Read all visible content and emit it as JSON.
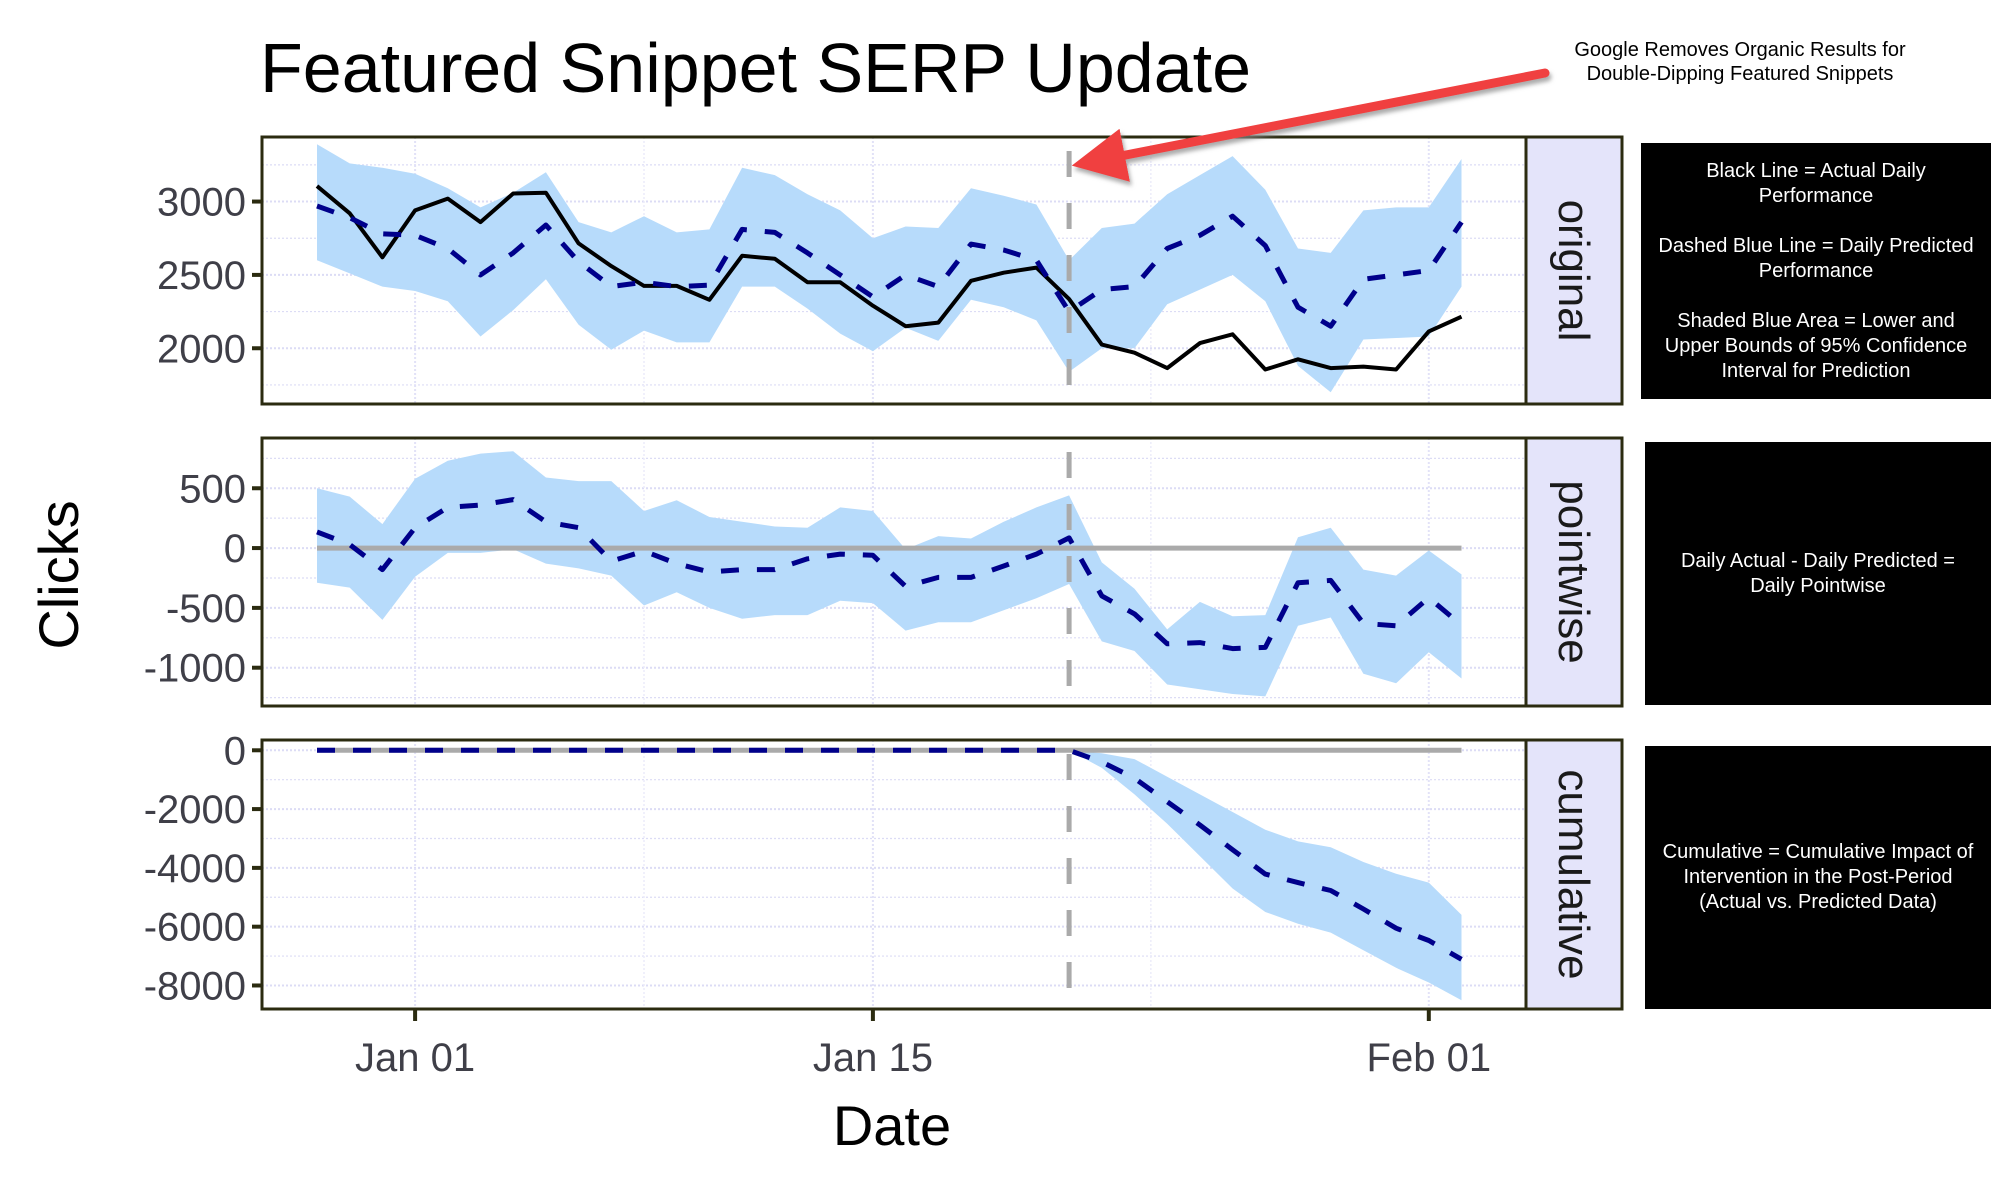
{
  "chart_data": {
    "type": "line",
    "title": "Featured Snippet SERP Update",
    "xlabel": "Date",
    "ylabel": "Clicks",
    "x_ticks": [
      "Jan 01",
      "Jan 15",
      "Feb 01"
    ],
    "x": [
      "Dec 29",
      "Dec 30",
      "Dec 31",
      "Jan 01",
      "Jan 02",
      "Jan 03",
      "Jan 04",
      "Jan 05",
      "Jan 06",
      "Jan 07",
      "Jan 08",
      "Jan 09",
      "Jan 10",
      "Jan 11",
      "Jan 12",
      "Jan 13",
      "Jan 14",
      "Jan 15",
      "Jan 16",
      "Jan 17",
      "Jan 18",
      "Jan 19",
      "Jan 20",
      "Jan 21",
      "Jan 22",
      "Jan 23",
      "Jan 24",
      "Jan 25",
      "Jan 26",
      "Jan 27",
      "Jan 28",
      "Jan 29",
      "Jan 30",
      "Jan 31",
      "Feb 01",
      "Feb 02"
    ],
    "intervention_date": "Jan 21",
    "grid": true,
    "panels": [
      {
        "name": "original",
        "y_ticks": [
          2000,
          2500,
          3000
        ],
        "ylim": [
          1620,
          3440
        ],
        "series": [
          {
            "name": "Actual",
            "style": "solid",
            "color": "#000000",
            "values": [
              3105,
              2920,
              2620,
              2940,
              3020,
              2860,
              3055,
              3060,
              2715,
              2560,
              2425,
              2425,
              2330,
              2630,
              2610,
              2450,
              2450,
              2290,
              2150,
              2175,
              2460,
              2515,
              2550,
              2335,
              2025,
              1970,
              1865,
              2035,
              2095,
              1855,
              1925,
              1865,
              1875,
              1855,
              2115,
              2215
            ]
          },
          {
            "name": "Predicted",
            "style": "dashed",
            "color": "#00008b",
            "values": [
              2970,
              2890,
              2780,
              2770,
              2680,
              2500,
              2650,
              2840,
              2590,
              2420,
              2450,
              2420,
              2430,
              2810,
              2790,
              2650,
              2500,
              2350,
              2500,
              2420,
              2710,
              2670,
              2600,
              2250,
              2400,
              2420,
              2680,
              2770,
              2900,
              2700,
              2280,
              2150,
              2470,
              2500,
              2530,
              2860
            ]
          },
          {
            "name": "Upper 95%",
            "style": "band-upper",
            "color": "#add8f7",
            "values": [
              3390,
              3260,
              3230,
              3190,
              3090,
              2960,
              3060,
              3200,
              2860,
              2790,
              2900,
              2790,
              2810,
              3230,
              3180,
              3050,
              2940,
              2750,
              2830,
              2820,
              3090,
              3040,
              2980,
              2600,
              2820,
              2850,
              3050,
              3180,
              3310,
              3080,
              2680,
              2650,
              2940,
              2960,
              2960,
              3290
            ]
          },
          {
            "name": "Lower 95%",
            "style": "band-lower",
            "color": "#add8f7",
            "values": [
              2600,
              2510,
              2420,
              2390,
              2320,
              2080,
              2260,
              2470,
              2160,
              1990,
              2120,
              2040,
              2040,
              2420,
              2420,
              2270,
              2100,
              1980,
              2140,
              2050,
              2330,
              2280,
              2190,
              1840,
              2000,
              2000,
              2300,
              2400,
              2500,
              2320,
              1880,
              1700,
              2060,
              2070,
              2080,
              2420
            ]
          }
        ]
      },
      {
        "name": "pointwise",
        "y_ticks": [
          -1000,
          -500,
          0,
          500
        ],
        "ylim": [
          -1320,
          920
        ],
        "series": [
          {
            "name": "Pointwise",
            "style": "dashed",
            "color": "#00008b",
            "values": [
              135,
              30,
              -180,
              170,
              340,
              360,
              405,
              220,
              170,
              -110,
              -25,
              -130,
              -200,
              -180,
              -180,
              -90,
              -50,
              -60,
              -320,
              -245,
              -245,
              -150,
              -50,
              85,
              -400,
              -550,
              -800,
              -790,
              -840,
              -830,
              -290,
              -270,
              -630,
              -650,
              -415,
              -645
            ]
          },
          {
            "name": "Upper 95%",
            "style": "band-upper",
            "color": "#add8f7",
            "values": [
              500,
              430,
              200,
              580,
              730,
              790,
              810,
              590,
              560,
              560,
              310,
              400,
              260,
              220,
              180,
              170,
              340,
              310,
              -10,
              100,
              80,
              220,
              340,
              440,
              -120,
              -340,
              -680,
              -450,
              -570,
              -560,
              90,
              170,
              -180,
              -230,
              -20,
              -220
            ]
          },
          {
            "name": "Lower 95%",
            "style": "band-lower",
            "color": "#add8f7",
            "values": [
              -290,
              -330,
              -600,
              -240,
              -40,
              -40,
              -10,
              -130,
              -170,
              -230,
              -480,
              -370,
              -500,
              -590,
              -560,
              -560,
              -440,
              -460,
              -690,
              -620,
              -620,
              -520,
              -420,
              -300,
              -780,
              -860,
              -1140,
              -1180,
              -1220,
              -1240,
              -650,
              -580,
              -1050,
              -1130,
              -870,
              -1090
            ]
          },
          {
            "name": "Zero",
            "style": "reference",
            "color": "#aaaaaa",
            "values": [
              0
            ]
          }
        ]
      },
      {
        "name": "cumulative",
        "y_ticks": [
          -8000,
          -6000,
          -4000,
          -2000,
          0
        ],
        "ylim": [
          -8800,
          350
        ],
        "series": [
          {
            "name": "Cumulative",
            "style": "dashed",
            "color": "#00008b",
            "values": [
              0,
              0,
              0,
              0,
              0,
              0,
              0,
              0,
              0,
              0,
              0,
              0,
              0,
              0,
              0,
              0,
              0,
              0,
              0,
              0,
              0,
              0,
              0,
              0,
              -400,
              -950,
              -1750,
              -2540,
              -3380,
              -4210,
              -4500,
              -4770,
              -5400,
              -6050,
              -6470,
              -7110
            ]
          },
          {
            "name": "Upper 95%",
            "style": "band-upper",
            "color": "#add8f7",
            "values": [
              0,
              0,
              0,
              0,
              0,
              0,
              0,
              0,
              0,
              0,
              0,
              0,
              0,
              0,
              0,
              0,
              0,
              0,
              0,
              0,
              0,
              0,
              0,
              0,
              -100,
              -300,
              -900,
              -1500,
              -2100,
              -2700,
              -3100,
              -3300,
              -3800,
              -4200,
              -4500,
              -5600
            ]
          },
          {
            "name": "Lower 95%",
            "style": "band-lower",
            "color": "#add8f7",
            "values": [
              0,
              0,
              0,
              0,
              0,
              0,
              0,
              0,
              0,
              0,
              0,
              0,
              0,
              0,
              0,
              0,
              0,
              0,
              0,
              0,
              0,
              0,
              0,
              0,
              -600,
              -1500,
              -2500,
              -3600,
              -4700,
              -5500,
              -5900,
              -6200,
              -6800,
              -7400,
              -7900,
              -8500
            ]
          },
          {
            "name": "Zero",
            "style": "reference",
            "color": "#aaaaaa",
            "values": [
              0
            ]
          }
        ]
      }
    ],
    "annotation": "Google Removes Organic Results for Double-Dipping Featured Snippets"
  },
  "annotation": {
    "line1": "Google Removes Organic Results for",
    "line2": "Double-Dipping Featured Snippets"
  },
  "notes": {
    "original": [
      "Black Line = Actual Daily Performance",
      "Dashed Blue Line = Daily Predicted Performance",
      "Shaded Blue Area = Lower and Upper Bounds of 95% Confidence Interval for Prediction"
    ],
    "pointwise": [
      "Daily Actual - Daily Predicted = Daily Pointwise"
    ],
    "cumulative": [
      "Cumulative = Cumulative Impact of Intervention in the Post-Period (Actual vs. Predicted Data)"
    ]
  },
  "colors": {
    "actual": "#000000",
    "predicted": "#00008b",
    "band": "#b7dbfb",
    "zero_line": "#aaaaaa",
    "intervention_line": "#aaaaaa",
    "strip_bg": "#e4e4fa",
    "panel_border": "#2b2b10",
    "arrow": "#f04040"
  }
}
